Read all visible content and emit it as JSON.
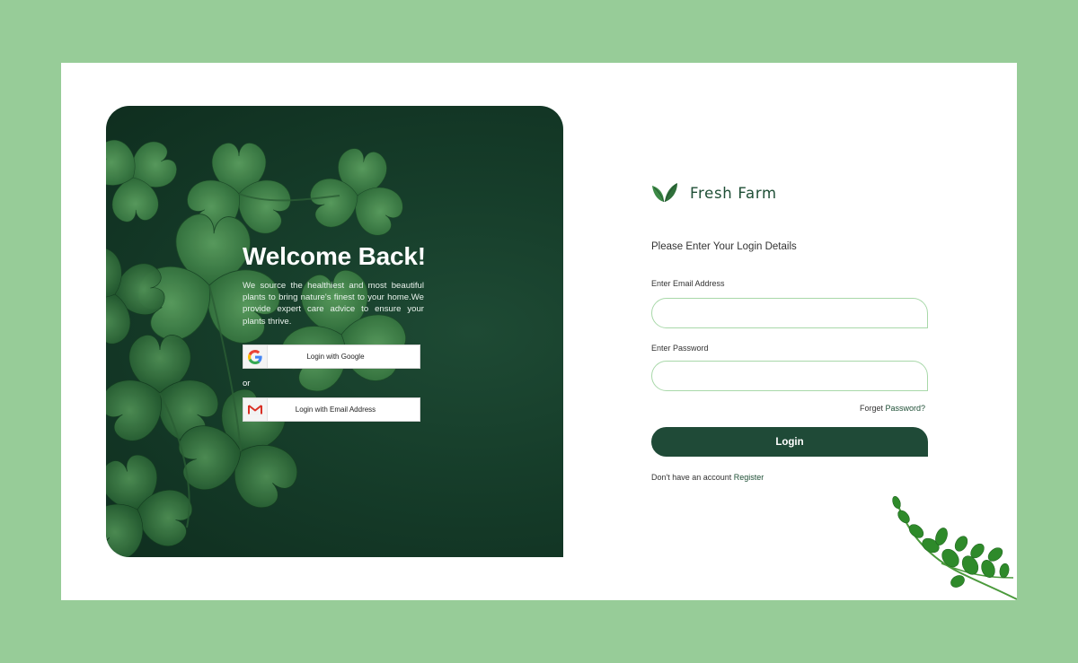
{
  "hero": {
    "title": "Welcome Back!",
    "description": "We source the healthiest and most beautiful plants to bring nature's finest to your home.We provide expert care advice to ensure your plants thrive.",
    "google_button": "Login with Google",
    "or_text": "or",
    "email_button": "Login with Email Address"
  },
  "brand": {
    "name": "Fresh Farm"
  },
  "form": {
    "prompt": "Please Enter Your Login Details",
    "email_label": "Enter Email Address",
    "email_value": "",
    "password_label": "Enter Password",
    "password_value": "",
    "forgot_prefix": "Forget ",
    "forgot_link": "Password?",
    "login_button": "Login",
    "register_prefix": "Don't have an account ",
    "register_link": "Register"
  },
  "colors": {
    "page_background": "#97cc98",
    "brand_green": "#1f4a37",
    "input_border": "#a8d8a9"
  },
  "icons": [
    "google-icon",
    "gmail-icon",
    "leaf-logo-icon",
    "vine-decoration"
  ]
}
